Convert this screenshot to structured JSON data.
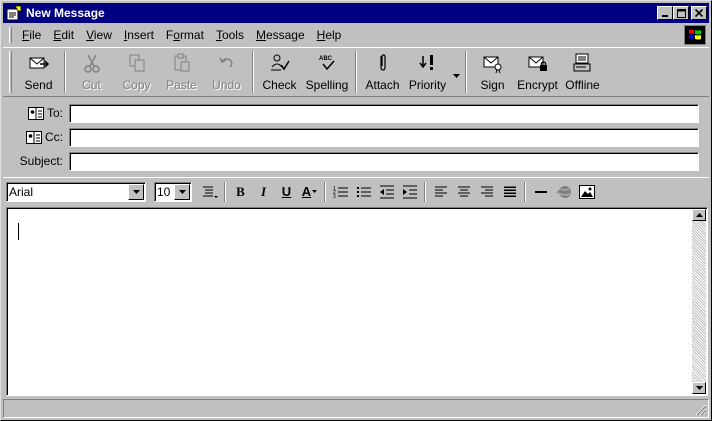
{
  "window": {
    "title": "New Message"
  },
  "menu": [
    {
      "label": "File",
      "accel": "F",
      "rest": "ile"
    },
    {
      "label": "Edit",
      "accel": "E",
      "rest": "dit"
    },
    {
      "label": "View",
      "accel": "V",
      "rest": "iew"
    },
    {
      "label": "Insert",
      "accel": "I",
      "rest": "nsert"
    },
    {
      "label": "Format",
      "accel": "o",
      "pre": "F",
      "rest": "rmat"
    },
    {
      "label": "Tools",
      "accel": "T",
      "rest": "ools"
    },
    {
      "label": "Message",
      "accel": "M",
      "rest": "essage"
    },
    {
      "label": "Help",
      "accel": "H",
      "rest": "elp"
    }
  ],
  "toolbar": {
    "send": "Send",
    "cut": "Cut",
    "copy": "Copy",
    "paste": "Paste",
    "undo": "Undo",
    "check": "Check",
    "spelling": "Spelling",
    "attach": "Attach",
    "priority": "Priority",
    "sign": "Sign",
    "encrypt": "Encrypt",
    "offline": "Offline"
  },
  "fields": {
    "to_label": "To:",
    "cc_label": "Cc:",
    "subject_label": "Subject:",
    "to_value": "",
    "cc_value": "",
    "subject_value": ""
  },
  "format": {
    "font": "Arial",
    "size": "10",
    "bold": "B",
    "italic": "I",
    "underline": "U",
    "font_color": "A"
  },
  "colors": {
    "titlebar": "#000080",
    "face": "#c0c0c0"
  }
}
